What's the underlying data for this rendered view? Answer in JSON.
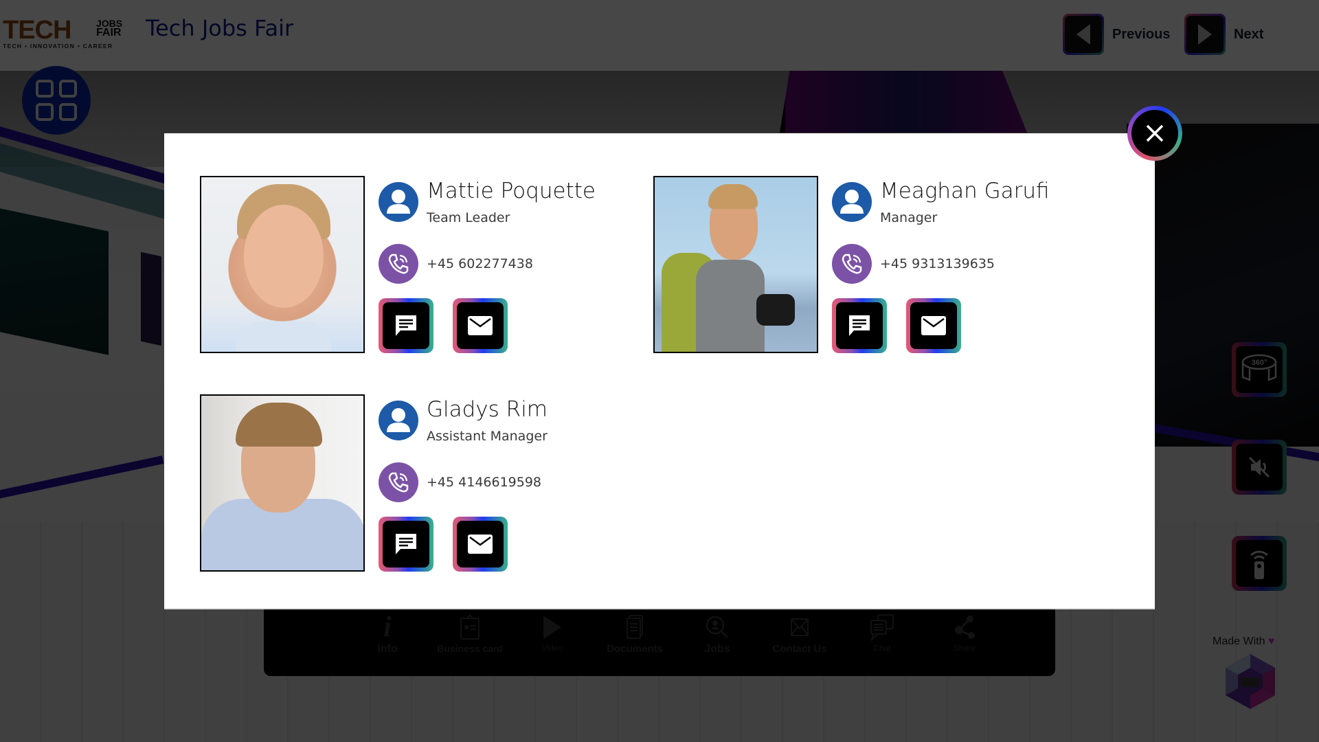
{
  "header": {
    "logo": {
      "word": "TECH",
      "stack_top": "JOBS",
      "stack_bottom": "FAIR",
      "tagline": "TECH • INNOVATION • CAREER"
    },
    "site_title": "Tech Jobs Fair",
    "previous_label": "Previous",
    "next_label": "Next"
  },
  "side_controls": {
    "view360_label": "360°",
    "made_with_label": "Made With",
    "heart": "♥"
  },
  "toolbar": {
    "items": [
      {
        "label": "Info",
        "icon": "info-icon"
      },
      {
        "label": "Business card",
        "icon": "business-card-icon"
      },
      {
        "label": "Video",
        "icon": "play-icon"
      },
      {
        "label": "Documents",
        "icon": "documents-icon"
      },
      {
        "label": "Jobs",
        "icon": "jobs-search-icon"
      },
      {
        "label": "Contact Us",
        "icon": "envelope-icon"
      },
      {
        "label": "Chat",
        "icon": "chat-bubbles-icon"
      },
      {
        "label": "Share",
        "icon": "share-icon"
      }
    ]
  },
  "modal": {
    "contacts": [
      {
        "name": "Mattie Poquette",
        "role": "Team Leader",
        "phone": "+45 602277438"
      },
      {
        "name": "Meaghan Garufi",
        "role": "Manager",
        "phone": "+45 9313139635"
      },
      {
        "name": "Gladys Rim",
        "role": "Assistant Manager",
        "phone": "+45 4146619598"
      }
    ]
  },
  "colors": {
    "avatar_blue": "#1d5aa8",
    "phone_purple": "#7c52a6",
    "title_blue": "#101a8c",
    "menu_blue": "#0a2aa8",
    "gradient_pink": "#e45a74",
    "gradient_blue": "#1e3cf0",
    "gradient_green": "#3ab08a"
  }
}
